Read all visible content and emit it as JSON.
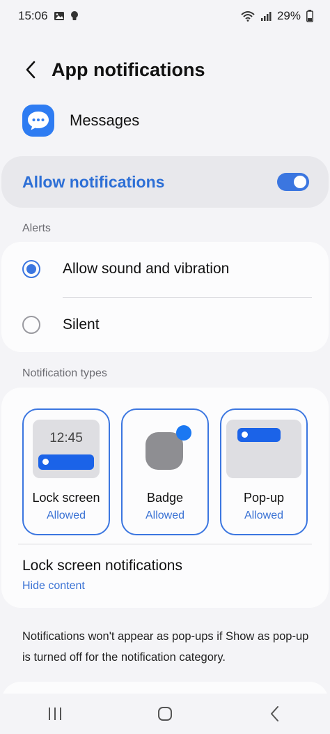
{
  "status_bar": {
    "time": "15:06",
    "battery": "29%",
    "icons": [
      "gallery-icon",
      "bulb-icon",
      "wifi-icon",
      "signal-icon",
      "battery-icon"
    ]
  },
  "header": {
    "title": "App notifications",
    "back_icon": "chevron-left-icon"
  },
  "app": {
    "name": "Messages",
    "icon": "messages-icon",
    "accent": "#2e7cf2"
  },
  "allow_notifications": {
    "label": "Allow notifications",
    "enabled": true,
    "accent": "#3b76e0"
  },
  "alerts": {
    "section_label": "Alerts",
    "options": [
      {
        "label": "Allow sound and vibration",
        "selected": true
      },
      {
        "label": "Silent",
        "selected": false
      }
    ]
  },
  "notification_types": {
    "section_label": "Notification types",
    "tiles": [
      {
        "title": "Lock screen",
        "status": "Allowed",
        "preview_time": "12:45"
      },
      {
        "title": "Badge",
        "status": "Allowed"
      },
      {
        "title": "Pop-up",
        "status": "Allowed"
      }
    ]
  },
  "lock_screen_notifications": {
    "title": "Lock screen notifications",
    "value": "Hide content"
  },
  "footnote": "Notifications won't appear as pop-ups if Show as pop-up is turned off for the notification category.",
  "nav_bar": {
    "buttons": [
      "recents-icon",
      "home-icon",
      "back-icon"
    ]
  }
}
